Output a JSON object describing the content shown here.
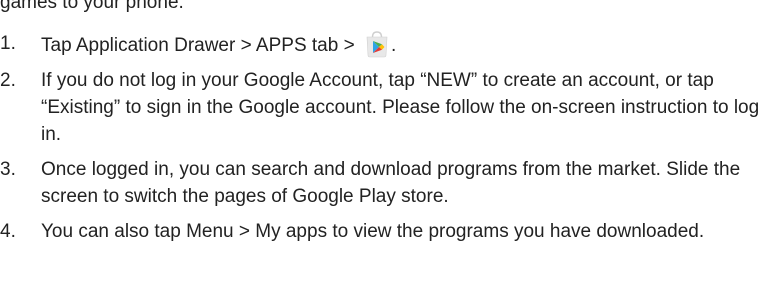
{
  "intro": {
    "fragment": "games to your phone."
  },
  "steps": [
    {
      "number": "1.",
      "text_before_icon": "Tap Application Drawer > APPS tab > ",
      "icon": "play-store-icon",
      "text_after_icon": "."
    },
    {
      "number": "2.",
      "text": "If you do not log in your Google Account, tap “NEW” to create an account, or tap “Existing” to sign in the Google account. Please follow the on-screen instruction to log in."
    },
    {
      "number": "3.",
      "text": "Once logged in, you can search and download programs from the market. Slide the screen to switch the pages of Google Play store."
    },
    {
      "number": "4.",
      "text": "You can also tap Menu > My apps to view the programs you have downloaded."
    }
  ],
  "colors": {
    "text": "#222222",
    "icon_bag": "#e8e8e8",
    "icon_play_blue": "#2fa4e7",
    "icon_play_green": "#4caf50",
    "icon_play_yellow": "#ffc107",
    "icon_play_red": "#e53935"
  }
}
